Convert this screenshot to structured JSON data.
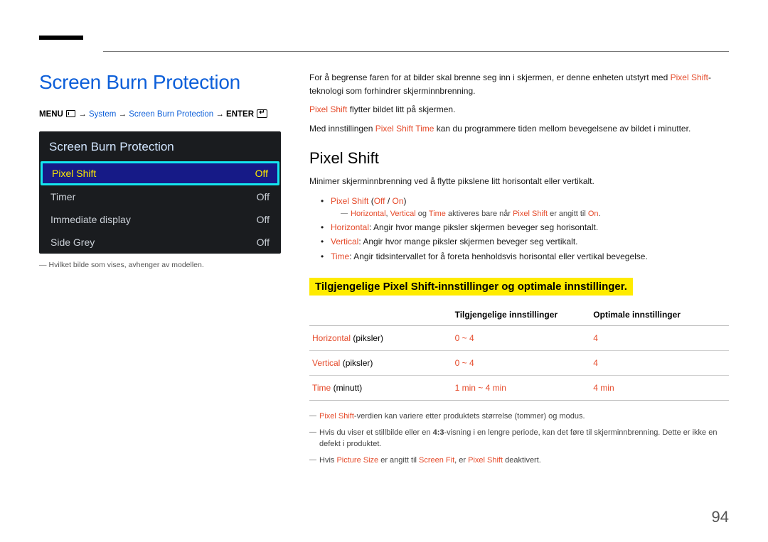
{
  "page_number": "94",
  "h1": "Screen Burn Protection",
  "breadcrumb": {
    "menu": "MENU",
    "system": "System",
    "sbp": "Screen Burn Protection",
    "enter": "ENTER"
  },
  "panel": {
    "title": "Screen Burn Protection",
    "items": [
      {
        "label": "Pixel Shift",
        "value": "Off",
        "selected": true
      },
      {
        "label": "Timer",
        "value": "Off",
        "selected": false
      },
      {
        "label": "Immediate display",
        "value": "Off",
        "selected": false
      },
      {
        "label": "Side Grey",
        "value": "Off",
        "selected": false
      }
    ]
  },
  "panel_footnote": "Hvilket bilde som vises, avhenger av modellen.",
  "intro": {
    "p1_a": "For å begrense faren for at bilder skal brenne seg inn i skjermen, er denne enheten utstyrt med ",
    "p1_b": "Pixel Shift",
    "p1_c": "-teknologi som forhindrer skjerminnbrenning.",
    "p2_a": "Pixel Shift",
    "p2_b": " flytter bildet litt på skjermen.",
    "p3_a": "Med innstillingen ",
    "p3_b": "Pixel Shift Time",
    "p3_c": " kan du programmere tiden mellom bevegelsene av bildet i minutter."
  },
  "h2": "Pixel Shift",
  "h2_sub": "Minimer skjerminnbrenning ved å flytte pikslene litt horisontalt eller vertikalt.",
  "bullets": {
    "b1_a": "Pixel Shift",
    "b1_b": " (",
    "b1_c": "Off",
    "b1_d": " / ",
    "b1_e": "On",
    "b1_f": ")",
    "sub1_a": "Horizontal",
    "sub1_b": ", ",
    "sub1_c": "Vertical",
    "sub1_d": " og ",
    "sub1_e": "Time",
    "sub1_f": " aktiveres bare når ",
    "sub1_g": "Pixel Shift",
    "sub1_h": " er angitt til ",
    "sub1_i": "On",
    "sub1_j": ".",
    "b2_a": "Horizontal",
    "b2_b": ": Angir hvor mange piksler skjermen beveger seg horisontalt.",
    "b3_a": "Vertical",
    "b3_b": ": Angir hvor mange piksler skjermen beveger seg vertikalt.",
    "b4_a": "Time",
    "b4_b": ": Angir tidsintervallet for å foreta henholdsvis horisontal eller vertikal bevegelse."
  },
  "highlight": "Tilgjengelige Pixel Shift-innstillinger og optimale innstillinger.",
  "table": {
    "h1": "",
    "h2": "Tilgjengelige innstillinger",
    "h3": "Optimale innstillinger",
    "rows": [
      {
        "label_red": "Horizontal",
        "label_black": " (piksler)",
        "avail": "0 ~ 4",
        "opt": "4"
      },
      {
        "label_red": "Vertical",
        "label_black": " (piksler)",
        "avail": "0 ~ 4",
        "opt": "4"
      },
      {
        "label_red": "Time",
        "label_black": " (minutt)",
        "avail": "1 min ~ 4 min",
        "opt": "4 min"
      }
    ]
  },
  "notes": {
    "n1_a": "Pixel Shift",
    "n1_b": "-verdien kan variere etter produktets størrelse (tommer) og modus.",
    "n2_a": "Hvis du viser et stillbilde eller en ",
    "n2_b": "4:3",
    "n2_c": "-visning i en lengre periode, kan det føre til skjerminnbrenning. Dette er ikke en defekt i produktet.",
    "n3_a": "Hvis ",
    "n3_b": "Picture Size",
    "n3_c": " er angitt til ",
    "n3_d": "Screen Fit",
    "n3_e": ", er ",
    "n3_f": "Pixel Shift",
    "n3_g": " deaktivert."
  }
}
